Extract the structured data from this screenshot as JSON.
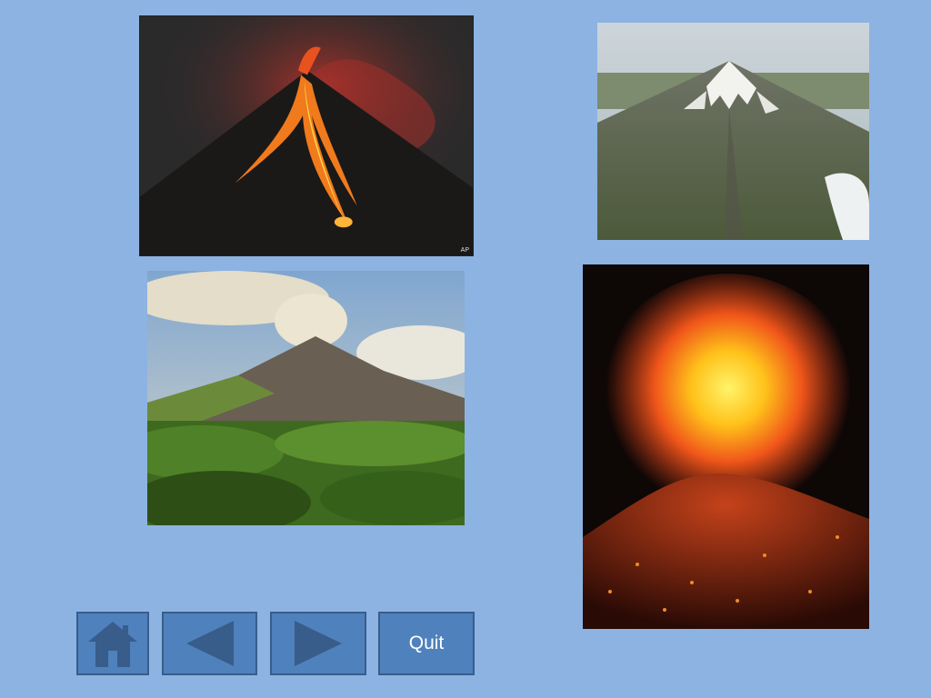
{
  "slide": {
    "background_color": "#8db3e2",
    "photos": [
      {
        "subject": "erupting-volcano-lava-flow-night",
        "credit": "AP"
      },
      {
        "subject": "snow-capped-volcano-aerial"
      },
      {
        "subject": "volcano-with-smoke-over-jungle"
      },
      {
        "subject": "explosive-volcanic-eruption"
      }
    ]
  },
  "navigation": {
    "home_icon": "home-icon",
    "prev_icon": "arrow-left-icon",
    "next_icon": "arrow-right-icon",
    "quit_label": "Quit",
    "button_color": "#4f81bd",
    "border_color": "#385d8a"
  }
}
